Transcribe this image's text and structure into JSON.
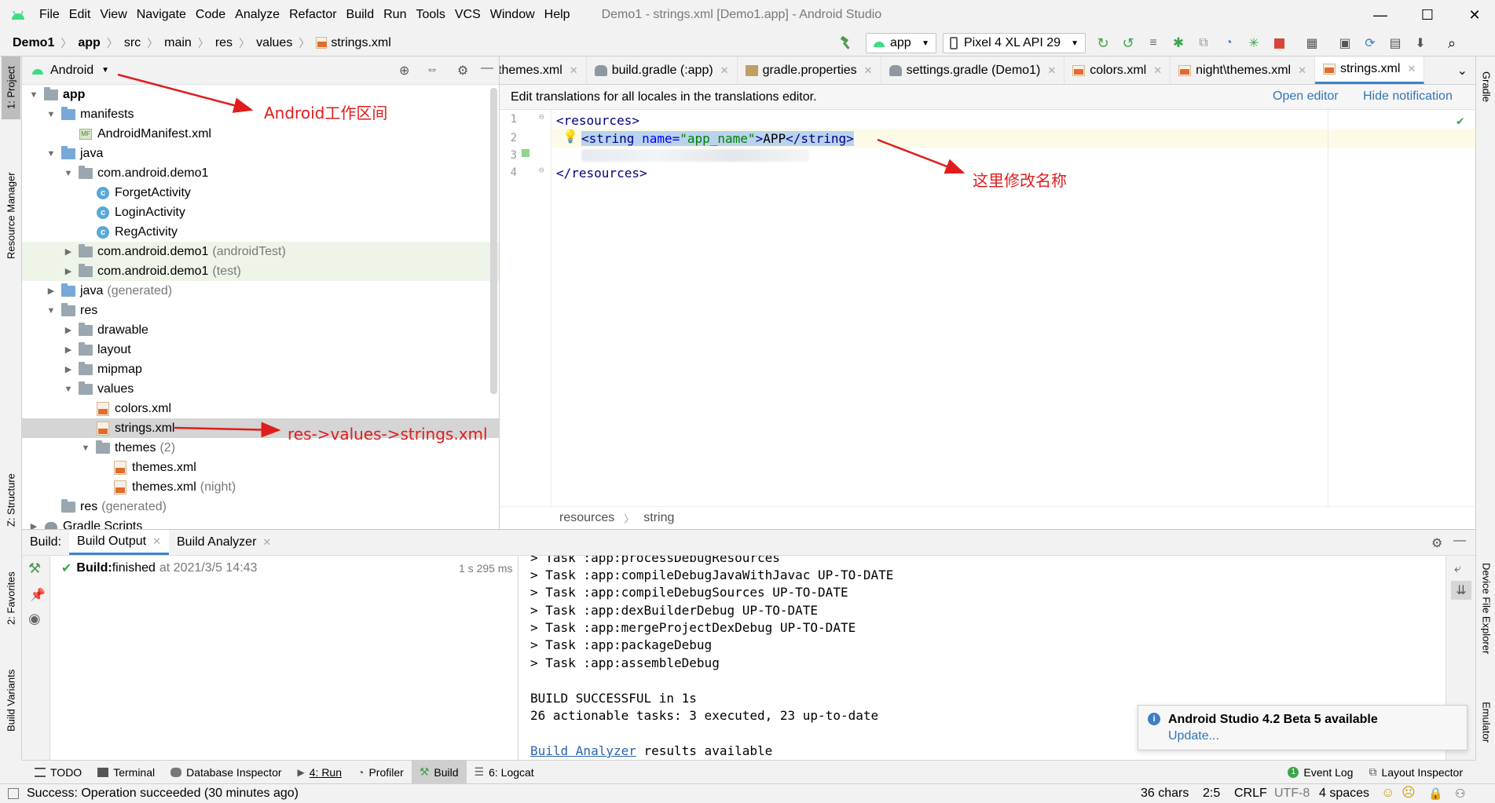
{
  "window": {
    "menu": [
      "File",
      "Edit",
      "View",
      "Navigate",
      "Code",
      "Analyze",
      "Refactor",
      "Build",
      "Run",
      "Tools",
      "VCS",
      "Window",
      "Help"
    ],
    "title": "Demo1 - strings.xml [Demo1.app] - Android Studio"
  },
  "navbar": {
    "crumbs": [
      "Demo1",
      "app",
      "src",
      "main",
      "res",
      "values",
      "strings.xml"
    ],
    "run_config": "app",
    "device": "Pixel 4 XL API 29"
  },
  "left_strip": {
    "project": "1: Project",
    "resource_manager": "Resource Manager",
    "structure": "Z: Structure",
    "favorites": "2: Favorites",
    "build_variants": "Build Variants"
  },
  "right_strip": {
    "gradle": "Gradle",
    "device_file_explorer": "Device File Explorer",
    "emulator": "Emulator"
  },
  "project": {
    "view_mode": "Android",
    "tree": [
      {
        "label": "app",
        "suffix": "",
        "indent": 0,
        "arrow": "▼",
        "icon": "folder",
        "bold": true
      },
      {
        "label": "manifests",
        "suffix": "",
        "indent": 1,
        "arrow": "▼",
        "icon": "folder-blue"
      },
      {
        "label": "AndroidManifest.xml",
        "suffix": "",
        "indent": 2,
        "arrow": "",
        "icon": "manifest"
      },
      {
        "label": "java",
        "suffix": "",
        "indent": 1,
        "arrow": "▼",
        "icon": "folder-blue"
      },
      {
        "label": "com.android.demo1",
        "suffix": "",
        "indent": 2,
        "arrow": "▼",
        "icon": "folder"
      },
      {
        "label": "ForgetActivity",
        "suffix": "",
        "indent": 3,
        "arrow": "",
        "icon": "class"
      },
      {
        "label": "LoginActivity",
        "suffix": "",
        "indent": 3,
        "arrow": "",
        "icon": "class"
      },
      {
        "label": "RegActivity",
        "suffix": "",
        "indent": 3,
        "arrow": "",
        "icon": "class"
      },
      {
        "label": "com.android.demo1",
        "suffix": "(androidTest)",
        "indent": 2,
        "arrow": "▶",
        "icon": "folder",
        "tinted": true
      },
      {
        "label": "com.android.demo1",
        "suffix": "(test)",
        "indent": 2,
        "arrow": "▶",
        "icon": "folder",
        "tinted": true
      },
      {
        "label": "java",
        "suffix": "(generated)",
        "indent": 1,
        "arrow": "▶",
        "icon": "folder-blue"
      },
      {
        "label": "res",
        "suffix": "",
        "indent": 1,
        "arrow": "▼",
        "icon": "folder"
      },
      {
        "label": "drawable",
        "suffix": "",
        "indent": 2,
        "arrow": "▶",
        "icon": "folder"
      },
      {
        "label": "layout",
        "suffix": "",
        "indent": 2,
        "arrow": "▶",
        "icon": "folder"
      },
      {
        "label": "mipmap",
        "suffix": "",
        "indent": 2,
        "arrow": "▶",
        "icon": "folder"
      },
      {
        "label": "values",
        "suffix": "",
        "indent": 2,
        "arrow": "▼",
        "icon": "folder"
      },
      {
        "label": "colors.xml",
        "suffix": "",
        "indent": 3,
        "arrow": "",
        "icon": "xml"
      },
      {
        "label": "strings.xml",
        "suffix": "",
        "indent": 3,
        "arrow": "",
        "icon": "xml",
        "selected": true
      },
      {
        "label": "themes",
        "suffix": "(2)",
        "indent": 3,
        "arrow": "▼",
        "icon": "folder"
      },
      {
        "label": "themes.xml",
        "suffix": "",
        "indent": 4,
        "arrow": "",
        "icon": "xml"
      },
      {
        "label": "themes.xml",
        "suffix": "(night)",
        "indent": 4,
        "arrow": "",
        "icon": "xml"
      },
      {
        "label": "res",
        "suffix": "(generated)",
        "indent": 1,
        "arrow": "",
        "icon": "folder"
      },
      {
        "label": "Gradle Scripts",
        "suffix": "",
        "indent": 0,
        "arrow": "▶",
        "icon": "gradle"
      }
    ]
  },
  "editor": {
    "tabs": [
      {
        "label": "themes.xml",
        "active": false
      },
      {
        "label": "build.gradle (:app)",
        "active": false
      },
      {
        "label": "gradle.properties",
        "active": false
      },
      {
        "label": "settings.gradle (Demo1)",
        "active": false
      },
      {
        "label": "colors.xml",
        "active": false
      },
      {
        "label": "night\\themes.xml",
        "active": false
      },
      {
        "label": "strings.xml",
        "active": true
      }
    ],
    "notice": "Edit translations for all locales in the translations editor.",
    "open_editor": "Open editor",
    "hide_notification": "Hide notification",
    "line_numbers": [
      "1",
      "2",
      "3",
      "4"
    ],
    "line1": "<resources>",
    "line2_open": "<string ",
    "line2_attr": "name=",
    "line2_val": "\"app_name\"",
    "line2_gt": ">",
    "line2_text": "APP",
    "line2_close": "</string>",
    "line4": "</resources>",
    "breadcrumb": [
      "resources",
      "string"
    ]
  },
  "build": {
    "label": "Build:",
    "tabs": [
      "Build Output",
      "Build Analyzer"
    ],
    "status_bold": "Build:",
    "status_text": " finished",
    "status_time": "at 2021/3/5 14:43",
    "duration": "1 s 295 ms",
    "output": [
      "> Task :app:processDebugResources",
      "> Task :app:compileDebugJavaWithJavac UP-TO-DATE",
      "> Task :app:compileDebugSources UP-TO-DATE",
      "> Task :app:dexBuilderDebug UP-TO-DATE",
      "> Task :app:mergeProjectDexDebug UP-TO-DATE",
      "> Task :app:packageDebug",
      "> Task :app:assembleDebug",
      "",
      "BUILD SUCCESSFUL in 1s",
      "26 actionable tasks: 3 executed, 23 up-to-date"
    ],
    "analyzer_link": "Build Analyzer",
    "analyzer_rest": " results available"
  },
  "popup": {
    "title": "Android Studio 4.2 Beta 5 available",
    "link": "Update..."
  },
  "bottom_tools": {
    "todo": "TODO",
    "terminal": "Terminal",
    "database": "Database Inspector",
    "run": "4: Run",
    "profiler": "Profiler",
    "build": "Build",
    "logcat": "6: Logcat",
    "event_log": "Event Log",
    "layout_inspector": "Layout Inspector"
  },
  "status": {
    "message": "Success: Operation succeeded (30 minutes ago)",
    "chars": "36 chars",
    "position": "2:5",
    "line_sep": "CRLF",
    "encoding": "UTF-8",
    "indent": "4 spaces"
  },
  "annotations": {
    "android_area": "Android工作区间",
    "rename_here": "这里修改名称",
    "path": "res->values->strings.xml"
  },
  "colors": {
    "accent": "#4083c9",
    "annotation": "#e01d1d",
    "success": "#3fa34d",
    "android": "#3ddc84"
  }
}
